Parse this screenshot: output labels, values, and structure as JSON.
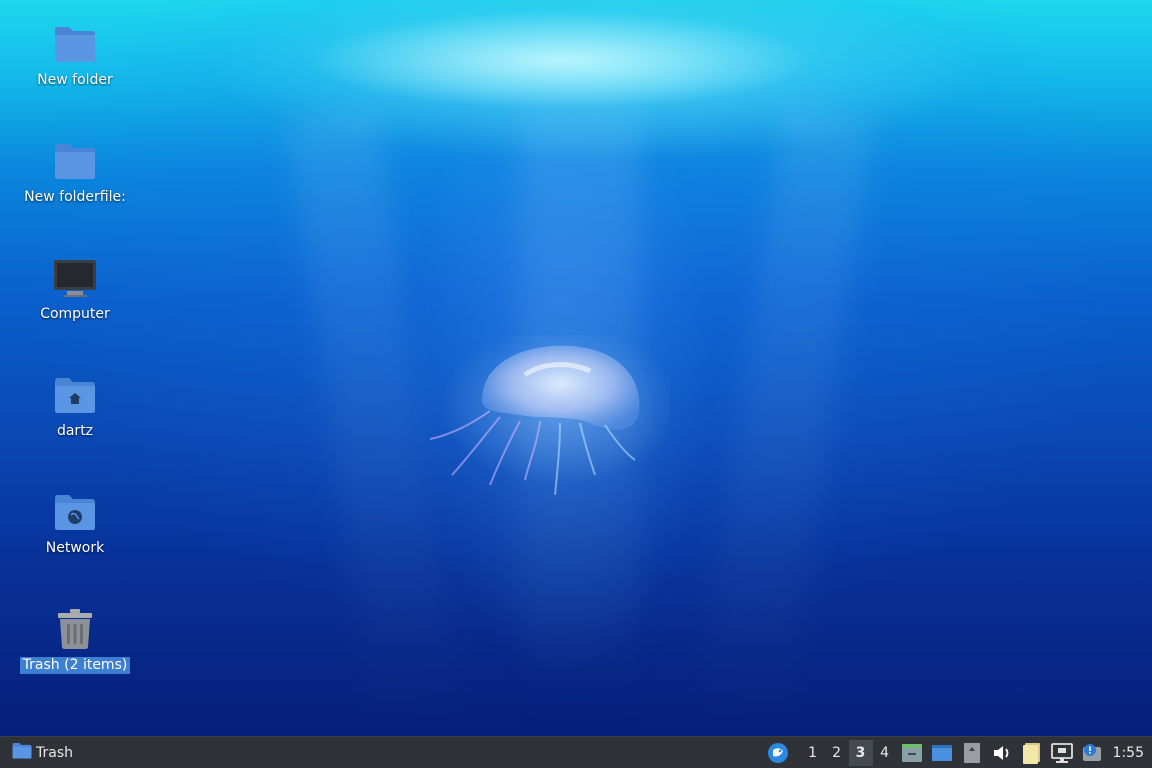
{
  "desktop": {
    "icons": [
      {
        "label": "New folder",
        "icon": "folder-icon",
        "selected": false
      },
      {
        "label": "New folderfile:",
        "icon": "folder-icon",
        "selected": false
      },
      {
        "label": "Computer",
        "icon": "computer-icon",
        "selected": false
      },
      {
        "label": "dartz",
        "icon": "home-folder-icon",
        "selected": false
      },
      {
        "label": "Network",
        "icon": "network-folder-icon",
        "selected": false
      },
      {
        "label": "Trash (2 items)",
        "icon": "trash-icon",
        "selected": true
      }
    ],
    "wallpaper": "underwater-jellyfish"
  },
  "taskbar": {
    "task_item": {
      "label": "Trash",
      "icon": "folder-icon"
    },
    "workspaces": [
      "1",
      "2",
      "3",
      "4"
    ],
    "active_workspace": "3",
    "tray_icons": [
      "whisker-menu-icon",
      "show-desktop-icon",
      "window-icon",
      "clipboard-icon",
      "volume-icon",
      "notes-icon",
      "network-wired-icon",
      "notification-icon"
    ],
    "clock": "1:55"
  },
  "colors": {
    "selection": "#3d7fd0",
    "folder": "#5a96e3",
    "panel": "#2f3338"
  }
}
